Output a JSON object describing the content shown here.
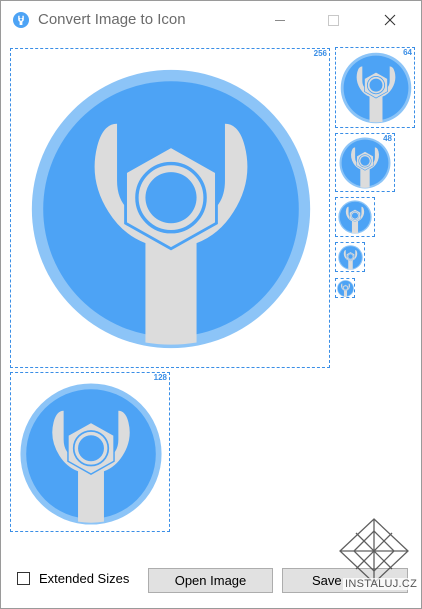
{
  "window": {
    "title": "Convert Image to Icon",
    "controls": {
      "minimize": "minimize-icon",
      "maximize": "maximize-icon",
      "close": "close-icon"
    }
  },
  "previews": [
    {
      "size_label": "256"
    },
    {
      "size_label": "64"
    },
    {
      "size_label": "48"
    },
    {
      "size_label": "128"
    }
  ],
  "icon_art": {
    "circle_color": "#4da3f5",
    "ring_color": "#8cc4f7",
    "wrench_color": "#dcdcdc",
    "nut_color": "#dcdcdc"
  },
  "footer": {
    "extended_sizes_label": "Extended Sizes",
    "extended_sizes_checked": false,
    "open_button_label": "Open Image",
    "save_button_label": "Save"
  },
  "watermark": {
    "text": "INSTALUJ.CZ"
  }
}
